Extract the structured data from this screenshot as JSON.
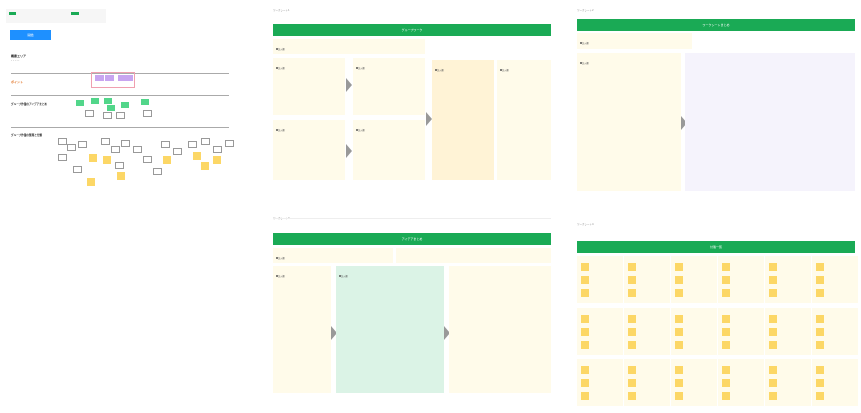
{
  "overview": {
    "badge_color": "#1aaa55",
    "button_color": "#1e90ff",
    "button_label": "開始",
    "sec1_title": "概要エリア",
    "sec2_title": "ポイント",
    "sec3_title": "グループ作業のアイデアまとめ",
    "sec4_title": "グループ作業の整理と分類"
  },
  "board1": {
    "banner": "グループワーク",
    "label": "ワークシート1"
  },
  "board2": {
    "banner": "ワークシートまとめ",
    "label": "ワークシート2"
  },
  "board3": {
    "banner": "アイデアまとめ",
    "label": "ワークシート3"
  },
  "board4": {
    "banner": "付箋一覧",
    "label": "ワークシート4"
  },
  "placeholder": "記入欄"
}
